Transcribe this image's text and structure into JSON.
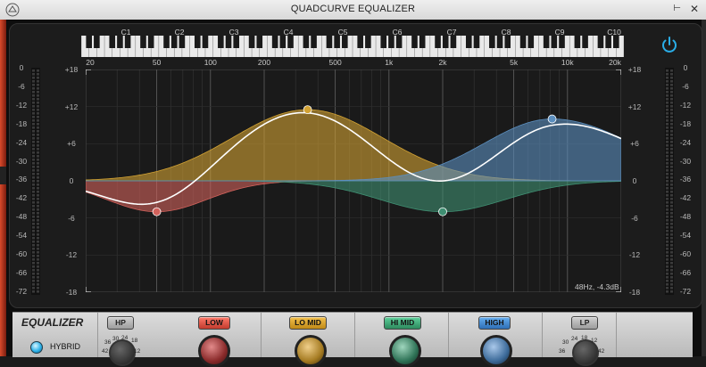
{
  "window": {
    "title": "QUADCURVE EQUALIZER"
  },
  "keyboard": {
    "octaves": [
      "C1",
      "C2",
      "C3",
      "C4",
      "C5",
      "C6",
      "C7",
      "C8",
      "C9",
      "C10"
    ]
  },
  "freq_axis": [
    "20",
    "50",
    "100",
    "200",
    "500",
    "1k",
    "2k",
    "5k",
    "10k",
    "20k"
  ],
  "gain_axis": [
    "+18",
    "+12",
    "+6",
    "0",
    "-6",
    "-12",
    "-18"
  ],
  "meter_scale": [
    "0",
    "-6",
    "-12",
    "-18",
    "-24",
    "-30",
    "-36",
    "-42",
    "-48",
    "-54",
    "-60",
    "-66",
    "-72"
  ],
  "readout": "48Hz, -4.3dB",
  "colors": {
    "low": "#d2625c",
    "lomid": "#d2a233",
    "himid": "#3f8f72",
    "high": "#5c8fbf",
    "power": "#2aaee8"
  },
  "bands": [
    {
      "key": "low",
      "name": "LOW",
      "freq_hz": 50,
      "gain_db": -5
    },
    {
      "key": "lomid",
      "name": "LO MID",
      "freq_hz": 350,
      "gain_db": 11.5
    },
    {
      "key": "himid",
      "name": "HI MID",
      "freq_hz": 2000,
      "gain_db": -5
    },
    {
      "key": "high",
      "name": "HIGH",
      "freq_hz": 8200,
      "gain_db": 10
    }
  ],
  "bottom": {
    "title": "EQUALIZER",
    "hybrid_label": "HYBRID",
    "hp_label": "HP",
    "lp_label": "LP",
    "low_label": "LOW",
    "lomid_label": "LO MID",
    "himid_label": "HI MID",
    "high_label": "HIGH",
    "hp_knob_ticks": [
      "36",
      "30",
      "24",
      "18",
      "42",
      "12"
    ],
    "lp_knob_ticks": [
      "30",
      "24",
      "18",
      "12",
      "36",
      "42"
    ]
  }
}
